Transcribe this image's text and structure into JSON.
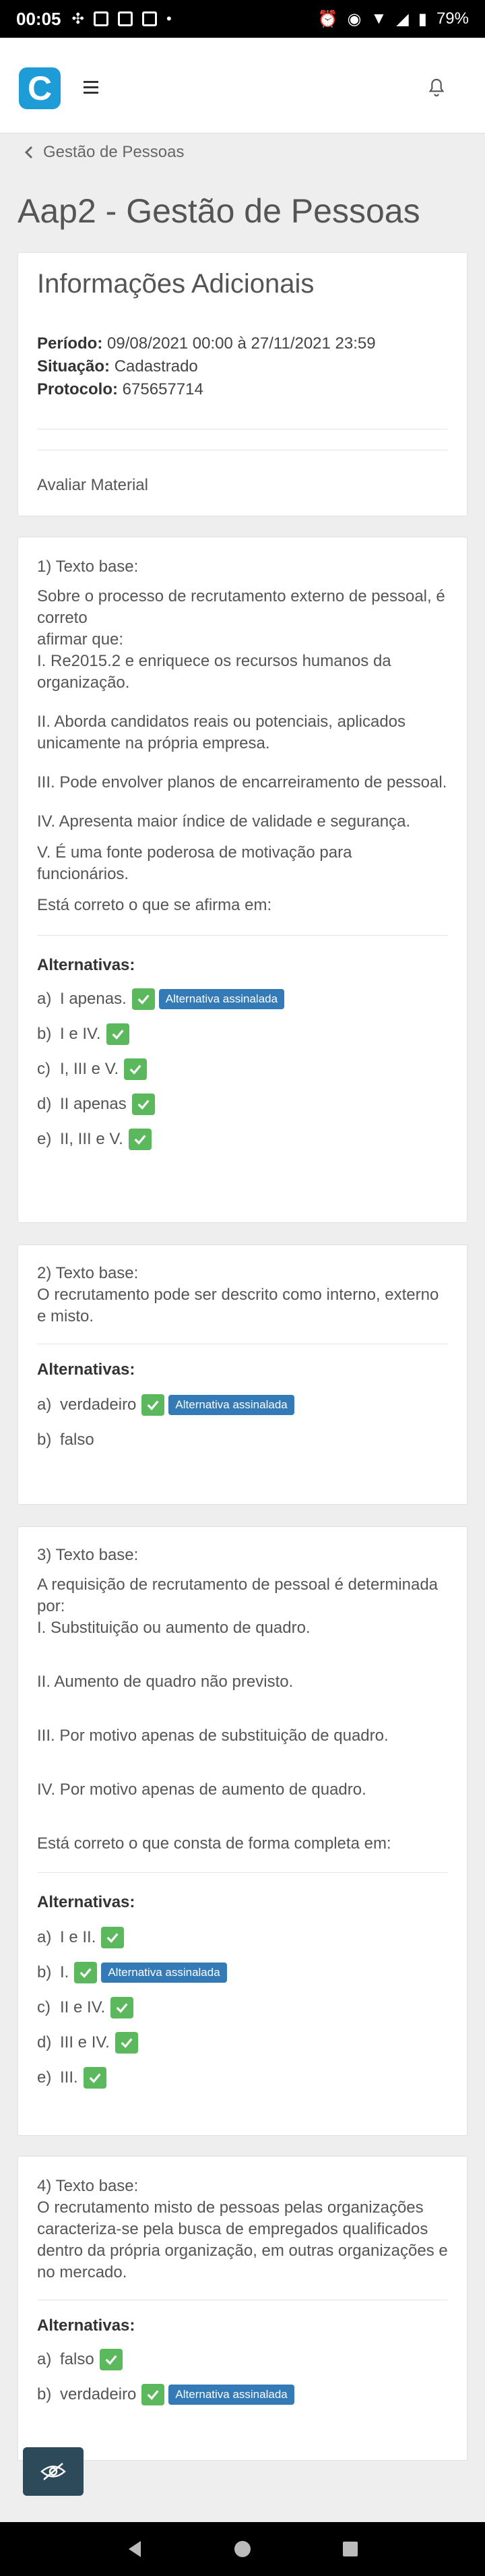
{
  "status_bar": {
    "time": "00:05",
    "battery": "79%"
  },
  "breadcrumb": {
    "label": "Gestão de Pessoas"
  },
  "page_title": "Aap2 - Gestão de Pessoas",
  "info": {
    "title": "Informações Adicionais",
    "periodo_label": "Período:",
    "periodo_value": "09/08/2021 00:00 à 27/11/2021 23:59",
    "situacao_label": "Situação:",
    "situacao_value": "Cadastrado",
    "protocolo_label": "Protocolo:",
    "protocolo_value": "675657714",
    "avaliar": "Avaliar Material"
  },
  "alternatives_label": "Alternativas:",
  "selected_badge": "Alternativa assinalada",
  "questions": [
    {
      "header": "1)   Texto base:",
      "text": [
        "Sobre o processo de recrutamento externo de pessoal, é correto",
        "afirmar que:",
        "I. Re2015.2 e enriquece os recursos humanos da organização.",
        "",
        "II. Aborda candidatos reais ou potenciais, aplicados unicamente na própria empresa.",
        "",
        "III. Pode envolver planos de encarreiramento de pessoal.",
        "",
        "IV. Apresenta maior índice de validade e segurança.",
        "V. É uma fonte poderosa de motivação para funcionários.",
        "Está correto o que se afirma em:"
      ],
      "alternatives": [
        {
          "letter": "a)",
          "text": "I apenas."
        },
        {
          "letter": "b)",
          "text": "I e IV."
        },
        {
          "letter": "c)",
          "text": "I, III e V."
        },
        {
          "letter": "d)",
          "text": "II apenas"
        },
        {
          "letter": "e)",
          "text": "II, III e V."
        }
      ]
    },
    {
      "header": "2)   Texto base:",
      "text": [
        "O recrutamento pode ser descrito como interno, externo e misto."
      ],
      "alternatives": [
        {
          "letter": "a)",
          "text": "verdadeiro"
        },
        {
          "letter": "b)",
          "text": "falso"
        }
      ]
    },
    {
      "header": "3)   Texto base:",
      "text": [
        "A requisição de recrutamento de pessoal é determinada por:",
        "I. Substituição ou aumento de quadro.",
        "",
        "II. Aumento de quadro não previsto.",
        "",
        "III. Por motivo apenas de substituição de quadro.",
        "",
        "IV. Por motivo apenas de aumento de quadro.",
        "",
        "Está correto o que consta de forma completa em:"
      ],
      "alternatives": [
        {
          "letter": "a)",
          "text": "I e II."
        },
        {
          "letter": "b)",
          "text": "I."
        },
        {
          "letter": "c)",
          "text": "II e IV."
        },
        {
          "letter": "d)",
          "text": "III e IV."
        },
        {
          "letter": "e)",
          "text": "III."
        }
      ]
    },
    {
      "header": "4)   Texto base:",
      "text": [
        "O recrutamento misto de pessoas pelas organizações caracteriza-se pela busca de empregados qualificados dentro da própria organização, em outras organizações e no mercado."
      ],
      "alternatives": [
        {
          "letter": "a)",
          "text": "falso"
        },
        {
          "letter": "b)",
          "text": "verdadeiro"
        }
      ]
    }
  ]
}
